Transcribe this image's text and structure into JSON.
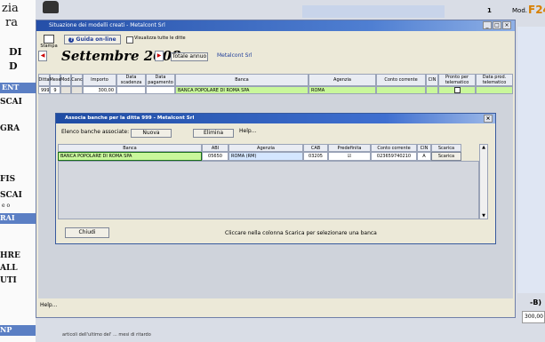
{
  "background": {
    "left_labels": [
      "zia",
      "ra",
      "DI",
      "D",
      "ENT",
      "SCAI",
      "GRA",
      "FIS",
      "SCAI",
      "e o",
      "RAI",
      "HRE",
      "ALL",
      "UTI",
      "NP"
    ],
    "mod_label": "Mod.",
    "mod_code": "F24",
    "page_num": "1",
    "right_value": "300,00",
    "right_bracket": "-B)",
    "bottom_note": "articoli dell'ultimo del' ... mesi di ritardo"
  },
  "window": {
    "title": "Situazione dei modelli creati - Metalcont Srl",
    "print_label": "Stampa",
    "guide_label": "Guida on-line",
    "show_all_label": "Visualizza tutte le ditte",
    "month_label": "Settembre 2008",
    "annual_button": "Totale annuo",
    "company": "Metalcont Srl",
    "help_label": "Help...",
    "columns": [
      "Ditta",
      "Mese",
      "Mod.",
      "Canc",
      "Importo",
      "Data scadenza",
      "Data pagamento",
      "Banca",
      "Agenzia",
      "Conto corrente",
      "CIN",
      "Pronto per telematico",
      "Data prod. telematico"
    ],
    "row": {
      "ditta": "999",
      "mese": "9",
      "mod": "",
      "canc": "",
      "importo": "300,00",
      "scadenza": "",
      "pagamento": "",
      "banca": "BANCA POPOLARE DI ROMA SPA",
      "agenzia": "ROMA",
      "conto": "",
      "cin": "",
      "pronto": "",
      "data_prod": ""
    }
  },
  "dialog": {
    "title": "Associa banche per la ditta 999 - Metalcont Srl",
    "list_label": "Elenco banche associate:",
    "new_button": "Nuova",
    "delete_button": "Elimina",
    "help_label": "Help...",
    "columns": [
      "Banca",
      "ABI",
      "Agenzia",
      "CAB",
      "Predefinita",
      "Conto corrente",
      "CIN",
      "Scarica"
    ],
    "row": {
      "banca": "BANCA POPOLARE DI ROMA SPA",
      "abi": "05650",
      "agenzia": "ROMA (RM)",
      "cab": "03205",
      "predefinita": "☑",
      "conto": "023659740210",
      "cin": "A",
      "scarica": "Scarica"
    },
    "close_button": "Chiudi",
    "hint": "Cliccare nella colonna Scarica per selezionare una banca"
  }
}
